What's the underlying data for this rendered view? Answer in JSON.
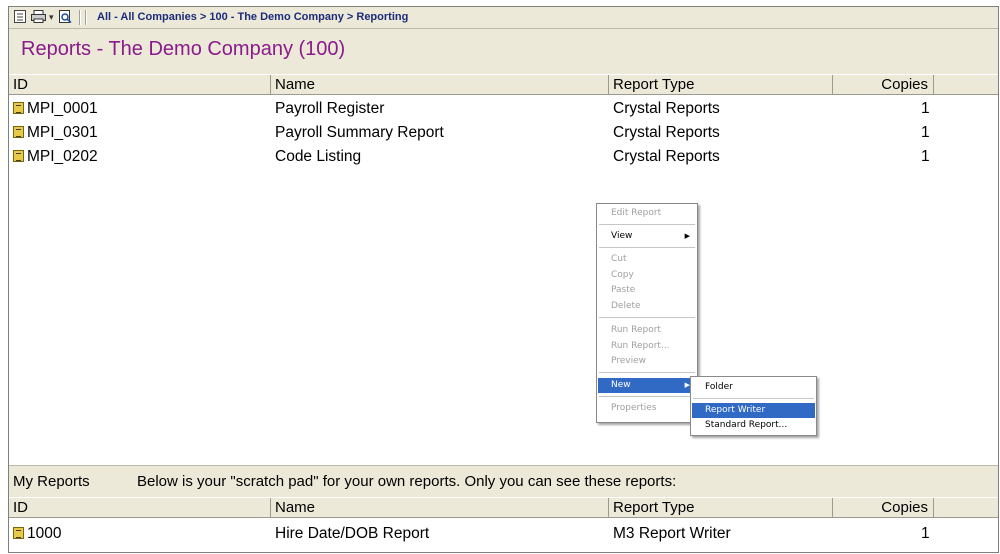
{
  "toolbar": {
    "breadcrumb": "All - All Companies > 100 - The Demo Company > Reporting",
    "icons": [
      "properties-icon",
      "print-icon",
      "dropdown-icon",
      "print-preview-icon"
    ]
  },
  "page": {
    "title": "Reports - The Demo Company (100)"
  },
  "reports": {
    "columns": [
      "ID",
      "Name",
      "Report Type",
      "Copies"
    ],
    "rows": [
      {
        "id": "MPI_0001",
        "name": "Payroll Register",
        "type": "Crystal Reports",
        "copies": "1"
      },
      {
        "id": "MPI_0301",
        "name": "Payroll Summary Report",
        "type": "Crystal Reports",
        "copies": "1"
      },
      {
        "id": "MPI_0202",
        "name": "Code Listing",
        "type": "Crystal Reports",
        "copies": "1"
      }
    ]
  },
  "context_menu": {
    "edit_report": "Edit Report",
    "view": "View",
    "cut": "Cut",
    "copy": "Copy",
    "paste": "Paste",
    "delete": "Delete",
    "run_report": "Run Report",
    "run_report_dialog": "Run Report...",
    "preview": "Preview",
    "new": "New",
    "properties": "Properties"
  },
  "submenu": {
    "folder": "Folder",
    "report_writer": "Report Writer",
    "standard_report": "Standard Report..."
  },
  "my_reports": {
    "label": "My Reports",
    "description": "Below is your \"scratch pad\" for your own reports.  Only you can see these reports:",
    "columns": [
      "ID",
      "Name",
      "Report Type",
      "Copies"
    ],
    "rows": [
      {
        "id": "1000",
        "name": "Hire Date/DOB Report",
        "type": "M3 Report Writer",
        "copies": "1"
      }
    ]
  },
  "colors": {
    "title": "#8b1a8b",
    "breadcrumb": "#1c2b7a",
    "highlight": "#316ac5",
    "panel": "#ece9d8"
  }
}
